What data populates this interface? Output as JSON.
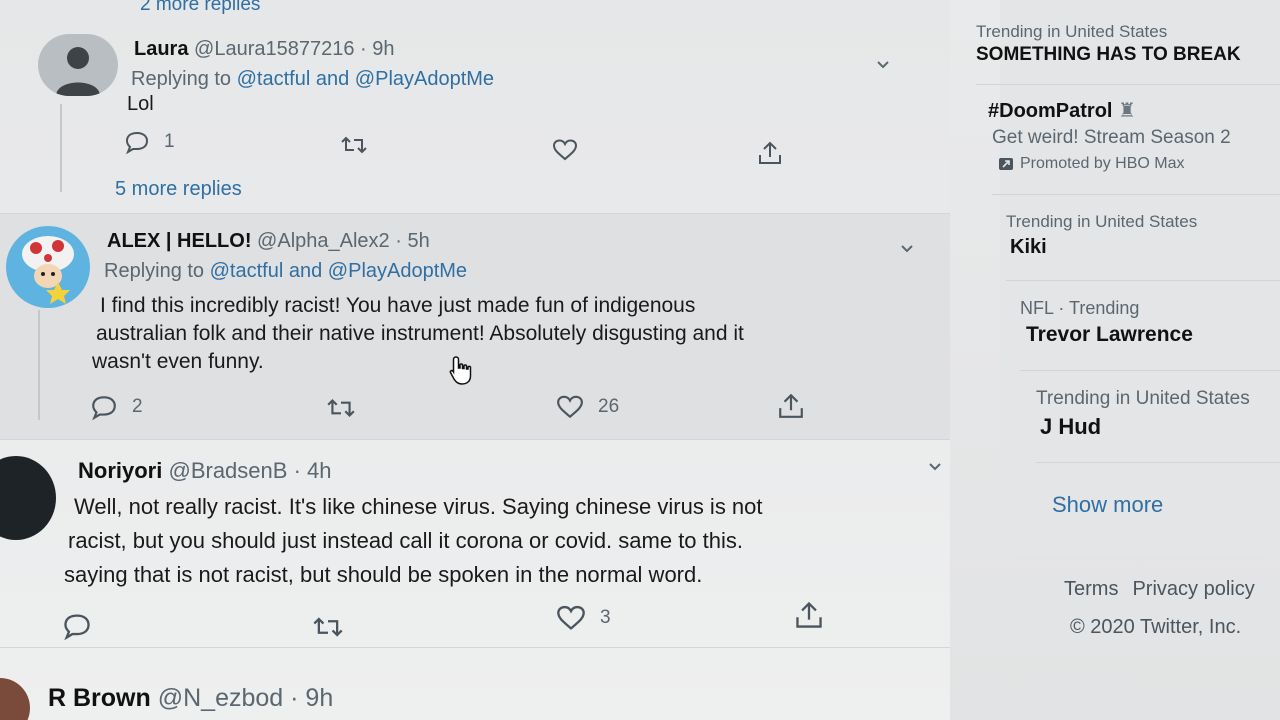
{
  "feed": {
    "top_more_replies": "2 more replies",
    "tweets": [
      {
        "name": "Laura",
        "handle": "@Laura15877216",
        "time": "9h",
        "replying_prefix": "Replying to",
        "mention1": "@tactful",
        "and": "and",
        "mention2": "@PlayAdoptMe",
        "text": "Lol",
        "reply_count": "1",
        "retweet_count": "",
        "like_count": "",
        "more_replies": "5 more replies"
      },
      {
        "name": "ALEX | HELLO!",
        "handle": "@Alpha_Alex2",
        "time": "5h",
        "replying_prefix": "Replying to",
        "mention1": "@tactful",
        "and": "and",
        "mention2": "@PlayAdoptMe",
        "text_line1": "I find this incredibly racist! You have just made fun of indigenous",
        "text_line2": "australian folk and their native instrument! Absolutely disgusting and it",
        "text_line3": "wasn't even funny.",
        "reply_count": "2",
        "retweet_count": "",
        "like_count": "26"
      },
      {
        "name": "Noriyori",
        "handle": "@BradsenB",
        "time": "4h",
        "text_line1": "Well, not really racist. It's like chinese virus. Saying chinese virus is not",
        "text_line2": "racist, but you should just instead call it corona or covid. same to this.",
        "text_line3": "saying that is not racist, but should be spoken in the normal word.",
        "reply_count": "",
        "retweet_count": "",
        "like_count": "3"
      },
      {
        "name": "R Brown",
        "handle": "@N_ezbod",
        "time": "9h"
      }
    ],
    "dot": "·"
  },
  "sidebar": {
    "trends": [
      {
        "meta": "Trending in United States",
        "title": "SOMETHING HAS TO BREAK"
      },
      {
        "title": "#DoomPatrol",
        "desc": "Get weird! Stream Season 2",
        "promo": "Promoted by HBO Max"
      },
      {
        "meta": "Trending in United States",
        "title": "Kiki"
      },
      {
        "meta": "NFL · Trending",
        "title": "Trevor Lawrence"
      },
      {
        "meta": "Trending in United States",
        "title": "J Hud"
      }
    ],
    "show_more": "Show more",
    "footer": {
      "terms": "Terms",
      "privacy": "Privacy policy",
      "copyright": "© 2020 Twitter, Inc."
    }
  },
  "icons": {
    "reply": "reply-icon",
    "retweet": "retweet-icon",
    "like": "heart-icon",
    "share": "share-icon",
    "caret": "chevron-down-icon",
    "promoted": "promoted-icon",
    "cursor": "hand-cursor-icon"
  },
  "colors": {
    "link": "#2f6fa3",
    "muted": "#5b6770",
    "text": "#14171a"
  }
}
